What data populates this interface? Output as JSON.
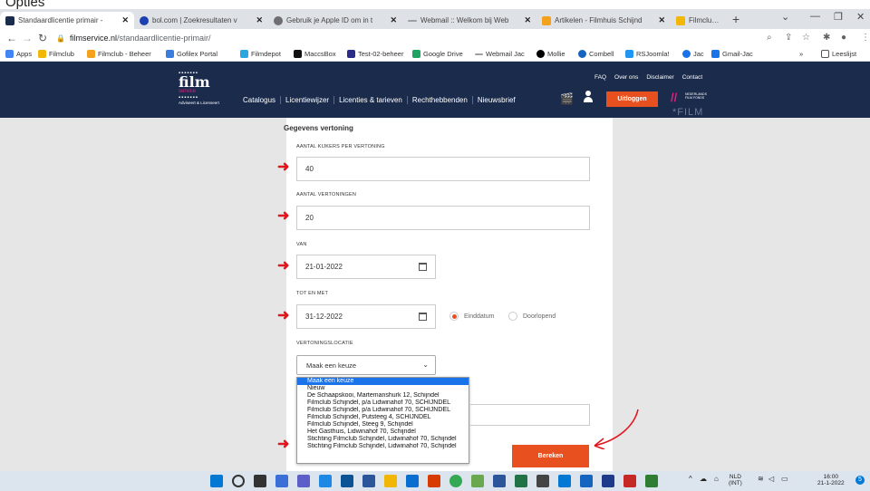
{
  "caption": "Opties",
  "browser": {
    "tabs": [
      {
        "label": "Standaardlicentie primair - ",
        "icon": "filmservice-favicon",
        "color": "#1a2b4c",
        "active": true
      },
      {
        "label": "bol.com | Zoekresultaten v",
        "icon": "bolcom-favicon",
        "color": "#1c3fb2",
        "active": false
      },
      {
        "label": "Gebruik je Apple ID om in t",
        "icon": "apple-favicon",
        "color": "#6e6e73",
        "active": false
      },
      {
        "label": "Webmail :: Welkom bij Web",
        "icon": "webmail-favicon",
        "color": "#9aa0a6",
        "active": false
      },
      {
        "label": "Artikelen - Filmhuis Schijnd",
        "icon": "joomla-favicon",
        "color": "#f4a21e",
        "active": false
      },
      {
        "label": "Filmclub Schijndel",
        "icon": "filmclub-favicon",
        "color": "#f2b705",
        "active": false
      }
    ],
    "new_tab": "+",
    "url_host": "filmservice.nl",
    "url_path": "/standaardlicentie-primair/",
    "bookmarks": [
      {
        "label": "Apps",
        "color": "#4285f4"
      },
      {
        "label": "Filmclub",
        "color": "#f2b705"
      },
      {
        "label": "Filmclub - Beheer",
        "color": "#f4a21e"
      },
      {
        "label": "Gofilex Portal",
        "color": "#3b7ddd"
      },
      {
        "label": "Filmdepot",
        "color": "#2aa6e0"
      },
      {
        "label": "MaccsBox",
        "color": "#111111"
      },
      {
        "label": "Test-02-beheer",
        "color": "#2b2b8a"
      },
      {
        "label": "Google Drive",
        "color": "#1fa463"
      },
      {
        "label": "Webmail Jac",
        "color": "#9aa0a6"
      },
      {
        "label": "Mollie",
        "color": "#000000"
      },
      {
        "label": "Combell",
        "color": "#1565c0"
      },
      {
        "label": "RSJoomla!",
        "color": "#2196f3"
      },
      {
        "label": "Jac",
        "color": "#1a73e8"
      },
      {
        "label": "Gmail-Jac",
        "color": "#1a73e8"
      }
    ],
    "reading_list": "Leeslijst"
  },
  "site": {
    "logo": {
      "dots": "▪▪▪▪▪▪▪",
      "word": "film",
      "sub": "service",
      "tagline": "Adviseert & Licenseert"
    },
    "top_links": [
      "FAQ",
      "Over ons",
      "Disclaimer",
      "Contact"
    ],
    "nav": [
      "Catalogus",
      "Licentiewijzer",
      "Licenties & tarieven",
      "Rechthebbenden",
      "Nieuwsbrief"
    ],
    "logout_label": "Uitloggen",
    "fund_logo": {
      "text": "NEDERLANDS FILM FONDS",
      "big": "*FILM"
    }
  },
  "form": {
    "section_title": "Gegevens vertoning",
    "visitors_label": "AANTAL KIJKERS PER VERTONING",
    "visitors_value": "40",
    "screenings_label": "AANTAL VERTONINGEN",
    "screenings_value": "20",
    "from_label": "VAN",
    "from_value": "21-01-2022",
    "to_label": "TOT EN MET",
    "to_value": "31-12-2022",
    "radio_end_date": "Einddatum",
    "radio_ongoing": "Doorlopend",
    "location_label": "VERTONINGSLOCATIE",
    "location_value": "Maak een keuze",
    "location_options": [
      "Maak een keuze",
      "Nieuw",
      "De Schaapskooi, Martemanshurk 12, Schijndel",
      "Filmclub Schijndel, p/a Lidwinahof 70, SCHIJNDEL",
      "Filmclub Schijndel, p/a Lidwinahof 70, SCHIJNDEL",
      "Filmclub Schijndel, Putsteeg 4, SCHIJNDEL",
      "Filmclub Schijndel, Steeg 9, Schijndel",
      "Het Gasthuis, Lidwinahof 70, Schijndel",
      "Stichting Filmclub Schijndel, Lidwinahof 70, Schijndel",
      "Stichting Filmclub Schijndel, Lidwinahof 70, Schijndel"
    ],
    "calculate_label": "Bereken"
  },
  "taskbar": {
    "lang": "NLD",
    "lang_sub": "(INT)",
    "time": "16:00",
    "date": "21-1-2022",
    "notifications": "5"
  },
  "colors": {
    "header": "#1a2b4c",
    "accent": "#e8511f",
    "annotation": "#e0161f",
    "selection": "#1a73e8"
  }
}
